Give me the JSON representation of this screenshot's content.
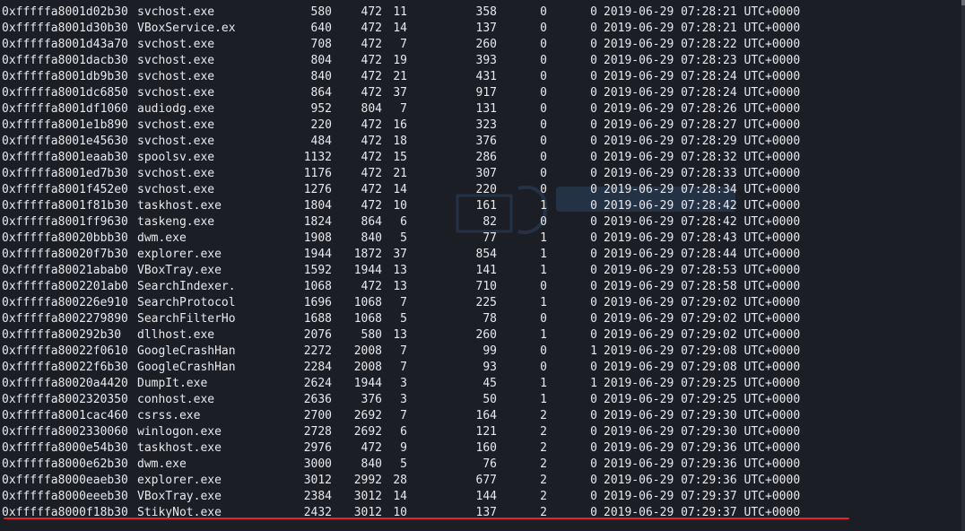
{
  "processes": [
    {
      "offset": "0xfffffa8001d02b30",
      "name": "svchost.exe",
      "pid": "580",
      "ppid": "472",
      "thds": "11",
      "hnds": "358",
      "sess": "0",
      "wow64": "0",
      "start": "2019-06-29 07:28:21 UTC+0000"
    },
    {
      "offset": "0xfffffa8001d30b30",
      "name": "VBoxService.ex",
      "pid": "640",
      "ppid": "472",
      "thds": "14",
      "hnds": "137",
      "sess": "0",
      "wow64": "0",
      "start": "2019-06-29 07:28:21 UTC+0000"
    },
    {
      "offset": "0xfffffa8001d43a70",
      "name": "svchost.exe",
      "pid": "708",
      "ppid": "472",
      "thds": "7",
      "hnds": "260",
      "sess": "0",
      "wow64": "0",
      "start": "2019-06-29 07:28:22 UTC+0000"
    },
    {
      "offset": "0xfffffa8001dacb30",
      "name": "svchost.exe",
      "pid": "804",
      "ppid": "472",
      "thds": "19",
      "hnds": "393",
      "sess": "0",
      "wow64": "0",
      "start": "2019-06-29 07:28:23 UTC+0000"
    },
    {
      "offset": "0xfffffa8001db9b30",
      "name": "svchost.exe",
      "pid": "840",
      "ppid": "472",
      "thds": "21",
      "hnds": "431",
      "sess": "0",
      "wow64": "0",
      "start": "2019-06-29 07:28:24 UTC+0000"
    },
    {
      "offset": "0xfffffa8001dc6850",
      "name": "svchost.exe",
      "pid": "864",
      "ppid": "472",
      "thds": "37",
      "hnds": "917",
      "sess": "0",
      "wow64": "0",
      "start": "2019-06-29 07:28:24 UTC+0000"
    },
    {
      "offset": "0xfffffa8001df1060",
      "name": "audiodg.exe",
      "pid": "952",
      "ppid": "804",
      "thds": "7",
      "hnds": "131",
      "sess": "0",
      "wow64": "0",
      "start": "2019-06-29 07:28:26 UTC+0000"
    },
    {
      "offset": "0xfffffa8001e1b890",
      "name": "svchost.exe",
      "pid": "220",
      "ppid": "472",
      "thds": "16",
      "hnds": "323",
      "sess": "0",
      "wow64": "0",
      "start": "2019-06-29 07:28:27 UTC+0000"
    },
    {
      "offset": "0xfffffa8001e45630",
      "name": "svchost.exe",
      "pid": "484",
      "ppid": "472",
      "thds": "18",
      "hnds": "376",
      "sess": "0",
      "wow64": "0",
      "start": "2019-06-29 07:28:29 UTC+0000"
    },
    {
      "offset": "0xfffffa8001eaab30",
      "name": "spoolsv.exe",
      "pid": "1132",
      "ppid": "472",
      "thds": "15",
      "hnds": "286",
      "sess": "0",
      "wow64": "0",
      "start": "2019-06-29 07:28:32 UTC+0000"
    },
    {
      "offset": "0xfffffa8001ed7b30",
      "name": "svchost.exe",
      "pid": "1176",
      "ppid": "472",
      "thds": "21",
      "hnds": "307",
      "sess": "0",
      "wow64": "0",
      "start": "2019-06-29 07:28:33 UTC+0000"
    },
    {
      "offset": "0xfffffa8001f452e0",
      "name": "svchost.exe",
      "pid": "1276",
      "ppid": "472",
      "thds": "14",
      "hnds": "220",
      "sess": "0",
      "wow64": "0",
      "start": "2019-06-29 07:28:34 UTC+0000"
    },
    {
      "offset": "0xfffffa8001f81b30",
      "name": "taskhost.exe",
      "pid": "1804",
      "ppid": "472",
      "thds": "10",
      "hnds": "161",
      "sess": "1",
      "wow64": "0",
      "start": "2019-06-29 07:28:42 UTC+0000"
    },
    {
      "offset": "0xfffffa8001ff9630",
      "name": "taskeng.exe",
      "pid": "1824",
      "ppid": "864",
      "thds": "6",
      "hnds": "82",
      "sess": "0",
      "wow64": "0",
      "start": "2019-06-29 07:28:42 UTC+0000"
    },
    {
      "offset": "0xfffffa80020bbb30",
      "name": "dwm.exe",
      "pid": "1908",
      "ppid": "840",
      "thds": "5",
      "hnds": "77",
      "sess": "1",
      "wow64": "0",
      "start": "2019-06-29 07:28:43 UTC+0000"
    },
    {
      "offset": "0xfffffa80020f7b30",
      "name": "explorer.exe",
      "pid": "1944",
      "ppid": "1872",
      "thds": "37",
      "hnds": "854",
      "sess": "1",
      "wow64": "0",
      "start": "2019-06-29 07:28:44 UTC+0000"
    },
    {
      "offset": "0xfffffa80021abab0",
      "name": "VBoxTray.exe",
      "pid": "1592",
      "ppid": "1944",
      "thds": "13",
      "hnds": "141",
      "sess": "1",
      "wow64": "0",
      "start": "2019-06-29 07:28:53 UTC+0000"
    },
    {
      "offset": "0xfffffa8002201ab0",
      "name": "SearchIndexer.",
      "pid": "1068",
      "ppid": "472",
      "thds": "13",
      "hnds": "710",
      "sess": "0",
      "wow64": "0",
      "start": "2019-06-29 07:28:58 UTC+0000"
    },
    {
      "offset": "0xfffffa800226e910",
      "name": "SearchProtocol",
      "pid": "1696",
      "ppid": "1068",
      "thds": "7",
      "hnds": "225",
      "sess": "1",
      "wow64": "0",
      "start": "2019-06-29 07:29:02 UTC+0000"
    },
    {
      "offset": "0xfffffa8002279890",
      "name": "SearchFilterHo",
      "pid": "1688",
      "ppid": "1068",
      "thds": "5",
      "hnds": "78",
      "sess": "0",
      "wow64": "0",
      "start": "2019-06-29 07:29:02 UTC+0000"
    },
    {
      "offset": "0xfffffa800292b30",
      "name": "dllhost.exe",
      "pid": "2076",
      "ppid": "580",
      "thds": "13",
      "hnds": "260",
      "sess": "1",
      "wow64": "0",
      "start": "2019-06-29 07:29:02 UTC+0000"
    },
    {
      "offset": "0xfffffa80022f0610",
      "name": "GoogleCrashHan",
      "pid": "2272",
      "ppid": "2008",
      "thds": "7",
      "hnds": "99",
      "sess": "0",
      "wow64": "1",
      "start": "2019-06-29 07:29:08 UTC+0000"
    },
    {
      "offset": "0xfffffa80022f6b30",
      "name": "GoogleCrashHan",
      "pid": "2284",
      "ppid": "2008",
      "thds": "7",
      "hnds": "93",
      "sess": "0",
      "wow64": "0",
      "start": "2019-06-29 07:29:08 UTC+0000"
    },
    {
      "offset": "0xfffffa80020a4420",
      "name": "DumpIt.exe",
      "pid": "2624",
      "ppid": "1944",
      "thds": "3",
      "hnds": "45",
      "sess": "1",
      "wow64": "1",
      "start": "2019-06-29 07:29:25 UTC+0000"
    },
    {
      "offset": "0xfffffa8002320350",
      "name": "conhost.exe",
      "pid": "2636",
      "ppid": "376",
      "thds": "3",
      "hnds": "50",
      "sess": "1",
      "wow64": "0",
      "start": "2019-06-29 07:29:25 UTC+0000"
    },
    {
      "offset": "0xfffffa8001cac460",
      "name": "csrss.exe",
      "pid": "2700",
      "ppid": "2692",
      "thds": "7",
      "hnds": "164",
      "sess": "2",
      "wow64": "0",
      "start": "2019-06-29 07:29:30 UTC+0000"
    },
    {
      "offset": "0xfffffa8002330060",
      "name": "winlogon.exe",
      "pid": "2728",
      "ppid": "2692",
      "thds": "6",
      "hnds": "121",
      "sess": "2",
      "wow64": "0",
      "start": "2019-06-29 07:29:30 UTC+0000"
    },
    {
      "offset": "0xfffffa8000e54b30",
      "name": "taskhost.exe",
      "pid": "2976",
      "ppid": "472",
      "thds": "9",
      "hnds": "160",
      "sess": "2",
      "wow64": "0",
      "start": "2019-06-29 07:29:36 UTC+0000"
    },
    {
      "offset": "0xfffffa8000e62b30",
      "name": "dwm.exe",
      "pid": "3000",
      "ppid": "840",
      "thds": "5",
      "hnds": "76",
      "sess": "2",
      "wow64": "0",
      "start": "2019-06-29 07:29:36 UTC+0000"
    },
    {
      "offset": "0xfffffa8000eaeb30",
      "name": "explorer.exe",
      "pid": "3012",
      "ppid": "2992",
      "thds": "28",
      "hnds": "677",
      "sess": "2",
      "wow64": "0",
      "start": "2019-06-29 07:29:36 UTC+0000"
    },
    {
      "offset": "0xfffffa8000eeeb30",
      "name": "VBoxTray.exe",
      "pid": "2384",
      "ppid": "3012",
      "thds": "14",
      "hnds": "144",
      "sess": "2",
      "wow64": "0",
      "start": "2019-06-29 07:29:37 UTC+0000"
    },
    {
      "offset": "0xfffffa8000f18b30",
      "name": "StikyNot.exe",
      "pid": "2432",
      "ppid": "3012",
      "thds": "10",
      "hnds": "137",
      "sess": "2",
      "wow64": "0",
      "start": "2019-06-29 07:29:37 UTC+0000"
    }
  ],
  "colors": {
    "background": "#1c1e26",
    "text": "#e9e9ec",
    "highlight_underline": "#e8222a"
  },
  "icons": {
    "watermark": "kali-dragon-logo"
  }
}
